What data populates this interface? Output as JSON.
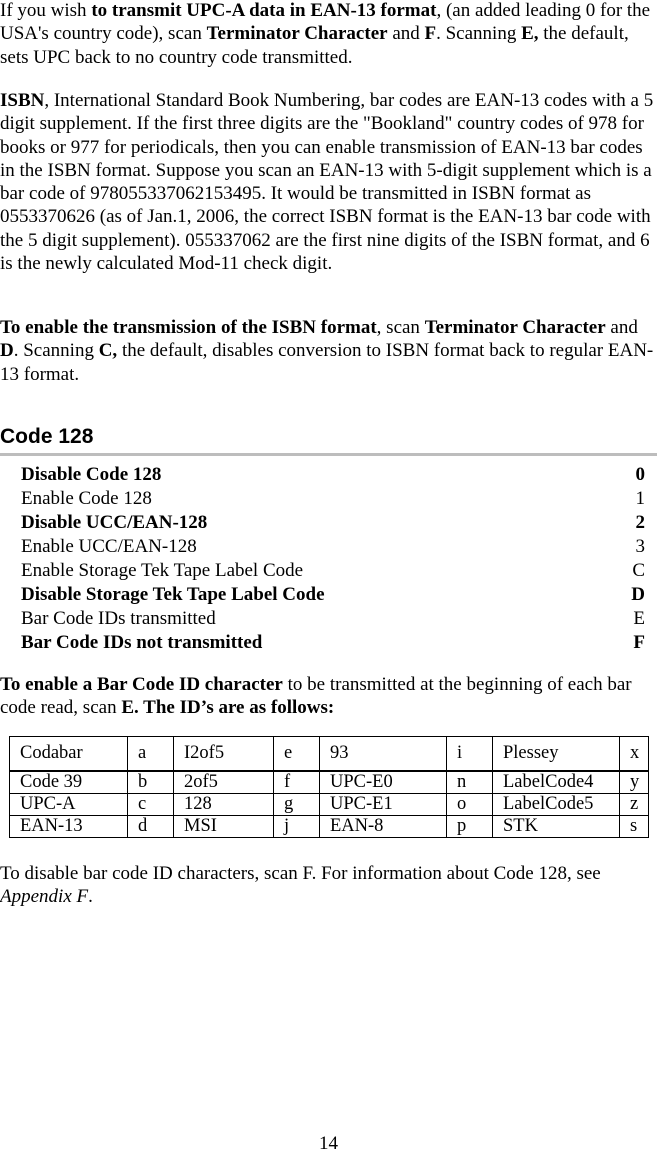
{
  "paragraphs": {
    "p1": {
      "t1": "If you wish ",
      "b1": "to transmit UPC-A data in EAN-13 format",
      "t2": ", (an added leading 0 for the USA's country code), scan ",
      "b2": "Terminator Character",
      "t3": " and ",
      "b3": "F",
      "t4": ". Scanning ",
      "b4": "E,",
      "t5": " the default, sets UPC back to no country code transmitted."
    },
    "p2": {
      "b1": "ISBN",
      "t1": ", International Standard Book Numbering, bar codes are EAN-13 codes with a 5 digit supplement. If the first three digits are the \"Bookland\" country codes of 978 for books or 977 for periodicals, then you can enable transmission of EAN-13 bar codes in the ISBN format. Suppose you scan an EAN-13 with 5-digit supplement which is a bar code of 978055337062153495.  It would be transmitted in ISBN format as 0553370626 (as of Jan.1, 2006, the correct ISBN format is the EAN-13 bar code with the 5 digit supplement). 055337062 are the first nine digits of the ISBN format, and 6 is the newly calculated Mod-11 check digit."
    },
    "p3": {
      "b1": "To enable the transmission of the ISBN format",
      "t1": ", scan ",
      "b2": "Terminator Character",
      "t2": " and ",
      "b3": "D",
      "t3": ".  Scanning ",
      "b4": "C,",
      "t4": " the default, disables conversion to ISBN format back to regular EAN-13 format."
    },
    "p4": {
      "b1": "To enable a Bar Code ID character",
      "t1": " to be transmitted at the beginning of each bar code read, scan ",
      "b2": "E. The ID’s are as follows:"
    },
    "p5": {
      "t1": "To disable bar code ID characters, scan F. For information about Code 128, see ",
      "i1": "Appendix F",
      "t2": "."
    }
  },
  "section": {
    "heading": "Code 128",
    "options": [
      {
        "label": "Disable Code 128",
        "code": "0",
        "bold": true
      },
      {
        "label": "Enable Code 128",
        "code": "1",
        "bold": false
      },
      {
        "label": "Disable UCC/EAN-128",
        "code": "2",
        "bold": true
      },
      {
        "label": "Enable UCC/EAN-128",
        "code": "3",
        "bold": false
      },
      {
        "label": "Enable Storage Tek Tape Label Code",
        "code": "C",
        "bold": false
      },
      {
        "label": "Disable Storage Tek Tape Label Code",
        "code": "D",
        "bold": true
      },
      {
        "label": "Bar Code IDs transmitted",
        "code": "E",
        "bold": false
      },
      {
        "label": "Bar Code IDs not transmitted",
        "code": "F",
        "bold": true
      }
    ]
  },
  "id_table": {
    "rows": [
      [
        "Codabar",
        "a",
        "I2of5",
        "e",
        "93",
        "i",
        "Plessey",
        "x"
      ],
      [
        "Code 39",
        "b",
        "2of5",
        "f",
        "UPC-E0",
        "n",
        "LabelCode4",
        "y"
      ],
      [
        "UPC-A",
        "c",
        "128",
        "g",
        "UPC-E1",
        "o",
        "LabelCode5",
        "z"
      ],
      [
        "EAN-13",
        "d",
        "MSI",
        "j",
        "EAN-8",
        "p",
        "STK",
        "s"
      ]
    ]
  },
  "footer": {
    "page_number": "14"
  }
}
